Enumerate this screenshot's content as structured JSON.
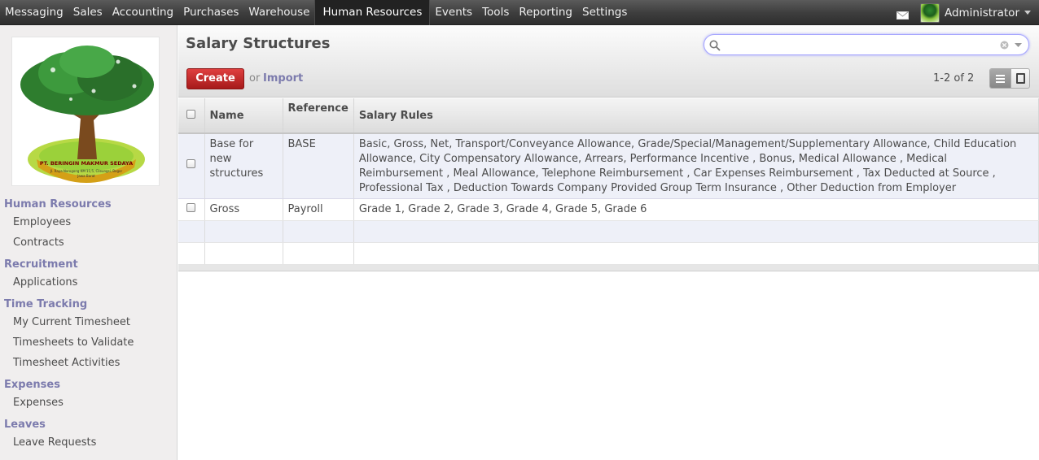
{
  "topbar": {
    "menu": [
      "Messaging",
      "Sales",
      "Accounting",
      "Purchases",
      "Warehouse",
      "Human Resources",
      "Events",
      "Tools",
      "Reporting",
      "Settings"
    ],
    "active": "Human Resources",
    "user_name": "Administrator"
  },
  "logo": {
    "company_text": "PT. BERINGIN MAKMUR SEDAYA"
  },
  "sidebar": {
    "sections": [
      {
        "title": "Human Resources",
        "items": [
          "Employees",
          "Contracts"
        ]
      },
      {
        "title": "Recruitment",
        "items": [
          "Applications"
        ]
      },
      {
        "title": "Time Tracking",
        "items": [
          "My Current Timesheet",
          "Timesheets to Validate",
          "Timesheet Activities"
        ]
      },
      {
        "title": "Expenses",
        "items": [
          "Expenses"
        ]
      },
      {
        "title": "Leaves",
        "items": [
          "Leave Requests"
        ]
      }
    ]
  },
  "page": {
    "title": "Salary Structures",
    "search_value": "",
    "create_label": "Create",
    "or_label": "or",
    "import_label": "Import",
    "pager": "1-2 of 2"
  },
  "table": {
    "columns": [
      "Name",
      "Reference",
      "Salary Rules"
    ],
    "rows": [
      {
        "name": "Base for new structures",
        "reference": "BASE",
        "salary_rules": "Basic, Gross, Net, Transport/Conveyance Allowance, Grade/Special/Management/Supplementary Allowance, Child Education Allowance, City Compensatory Allowance, Arrears, Performance Incentive , Bonus, Medical Allowance , Medical Reimbursement , Meal Allowance, Telephone Reimbursement , Car Expenses Reimbursement , Tax Deducted at Source , Professional Tax , Deduction Towards Company Provided Group Term Insurance , Other Deduction from Employer"
      },
      {
        "name": "Gross",
        "reference": "Payroll",
        "salary_rules": "Grade 1, Grade 2, Grade 3, Grade 4, Grade 5, Grade 6"
      }
    ]
  },
  "colors": {
    "accent": "#7c7bad",
    "create_button": "#c72727",
    "topbar": "#3f3f3f",
    "row_highlight": "#eef0f8"
  }
}
